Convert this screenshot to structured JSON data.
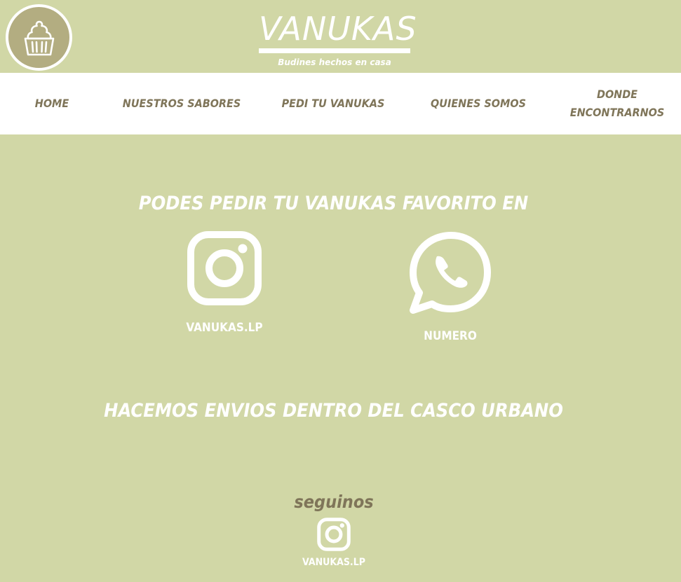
{
  "header": {
    "brand_title": "VANUKAS",
    "brand_subtitle": "Budines hechos en casa",
    "logo_icon": "cupcake-icon"
  },
  "nav": {
    "items": [
      {
        "label": "HOME"
      },
      {
        "label": "NUESTROS SABORES"
      },
      {
        "label": "PEDI TU VANUKAS"
      },
      {
        "label": "QUIENES SOMOS"
      },
      {
        "label": "DONDE ENCONTRARNOS"
      }
    ]
  },
  "main": {
    "headline": "PODES PEDIR TU VANUKAS FAVORITO EN",
    "contacts": [
      {
        "icon": "instagram-icon",
        "label": "VANUKAS.LP"
      },
      {
        "icon": "whatsapp-icon",
        "label": "NUMERO"
      }
    ],
    "shipping_text": "HACEMOS ENVIOS DENTRO DEL CASCO URBANO"
  },
  "footer": {
    "title": "seguinos",
    "icon": "instagram-icon",
    "label": "VANUKAS.LP"
  },
  "colors": {
    "background": "#d1d7a6",
    "nav_background": "#ffffff",
    "nav_text": "#7f7559",
    "logo_fill": "#b3ad81",
    "text_white": "#ffffff"
  }
}
